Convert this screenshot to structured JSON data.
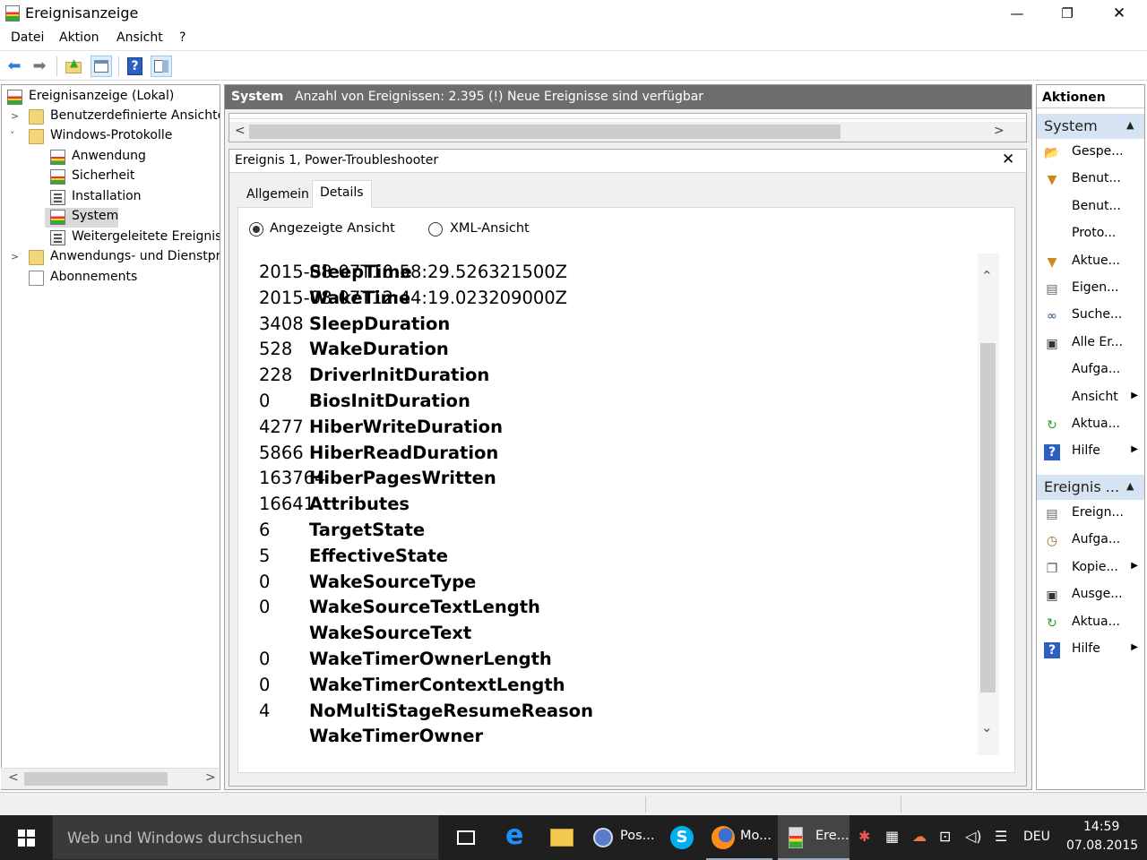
{
  "window": {
    "title": "Ereignisanzeige",
    "controls": {
      "minimize": "—",
      "maximize": "❐",
      "close": "✕"
    }
  },
  "menu": [
    "Datei",
    "Aktion",
    "Ansicht",
    "?"
  ],
  "tree": {
    "root": "Ereignisanzeige (Lokal)",
    "custom_views": "Benutzerdefinierte Ansichten",
    "windows_logs": "Windows-Protokolle",
    "logs": [
      "Anwendung",
      "Sicherheit",
      "Installation",
      "System",
      "Weitergeleitete Ereignisse"
    ],
    "app_services": "Anwendungs- und Dienstprotokolle",
    "subscriptions": "Abonnements"
  },
  "center": {
    "log_name": "System",
    "summary": "Anzahl von Ereignissen: 2.395 (!) Neue Ereignisse sind verfügbar",
    "event_title": "Ereignis 1, Power-Troubleshooter",
    "tabs": [
      "Allgemein",
      "Details"
    ],
    "view_options": [
      "Angezeigte Ansicht",
      "XML-Ansicht"
    ],
    "details": [
      {
        "key": "SleepTime",
        "value": "2015-08-07T10:58:29.526321500Z"
      },
      {
        "key": "WakeTime",
        "value": "2015-08-07T12:44:19.023209000Z"
      },
      {
        "key": "SleepDuration",
        "value": "3408"
      },
      {
        "key": "WakeDuration",
        "value": "528"
      },
      {
        "key": "DriverInitDuration",
        "value": "228"
      },
      {
        "key": "BiosInitDuration",
        "value": "0"
      },
      {
        "key": "HiberWriteDuration",
        "value": "4277"
      },
      {
        "key": "HiberReadDuration",
        "value": "5866"
      },
      {
        "key": "HiberPagesWritten",
        "value": "163764"
      },
      {
        "key": "Attributes",
        "value": "16641"
      },
      {
        "key": "TargetState",
        "value": "6"
      },
      {
        "key": "EffectiveState",
        "value": "5"
      },
      {
        "key": "WakeSourceType",
        "value": "0"
      },
      {
        "key": "WakeSourceTextLength",
        "value": "0"
      },
      {
        "key": "WakeSourceText",
        "value": ""
      },
      {
        "key": "WakeTimerOwnerLength",
        "value": "0"
      },
      {
        "key": "WakeTimerContextLength",
        "value": "0"
      },
      {
        "key": "NoMultiStageResumeReason",
        "value": "4"
      },
      {
        "key": "WakeTimerOwner",
        "value": ""
      }
    ]
  },
  "actions": {
    "header": "Aktionen",
    "section1": "System",
    "section1_items": [
      {
        "label": "Gespe...",
        "icon": "open-folder-icon"
      },
      {
        "label": "Benut...",
        "icon": "filter-icon"
      },
      {
        "label": "Benut...",
        "icon": ""
      },
      {
        "label": "Proto...",
        "icon": ""
      },
      {
        "label": "Aktue...",
        "icon": "filter-icon"
      },
      {
        "label": "Eigen...",
        "icon": "properties-icon"
      },
      {
        "label": "Suche...",
        "icon": "binoculars-icon"
      },
      {
        "label": "Alle Er...",
        "icon": "save-icon"
      },
      {
        "label": "Aufga...",
        "icon": ""
      },
      {
        "label": "Ansicht",
        "icon": "",
        "submenu": true
      },
      {
        "label": "Aktua...",
        "icon": "refresh-icon"
      },
      {
        "label": "Hilfe",
        "icon": "help-icon",
        "submenu": true
      }
    ],
    "section2": "Ereignis ...",
    "section2_items": [
      {
        "label": "Ereign...",
        "icon": "event-properties-icon"
      },
      {
        "label": "Aufga...",
        "icon": "task-icon"
      },
      {
        "label": "Kopie...",
        "icon": "copy-icon",
        "submenu": true
      },
      {
        "label": "Ausge...",
        "icon": "save-icon"
      },
      {
        "label": "Aktua...",
        "icon": "refresh-icon"
      },
      {
        "label": "Hilfe",
        "icon": "help-icon",
        "submenu": true
      }
    ]
  },
  "taskbar": {
    "search_placeholder": "Web und Windows durchsuchen",
    "apps": [
      "Pos...",
      "Mo...",
      "Ere..."
    ],
    "language": "DEU",
    "time": "14:59",
    "date": "07.08.2015"
  },
  "colors": {
    "selection": "#cce8ff",
    "header_gray": "#6d6d6d",
    "action_header": "#d5e3f3",
    "taskbar": "#1f1f1f",
    "edge_blue": "#1e90ff",
    "skype_blue": "#00aff0"
  }
}
